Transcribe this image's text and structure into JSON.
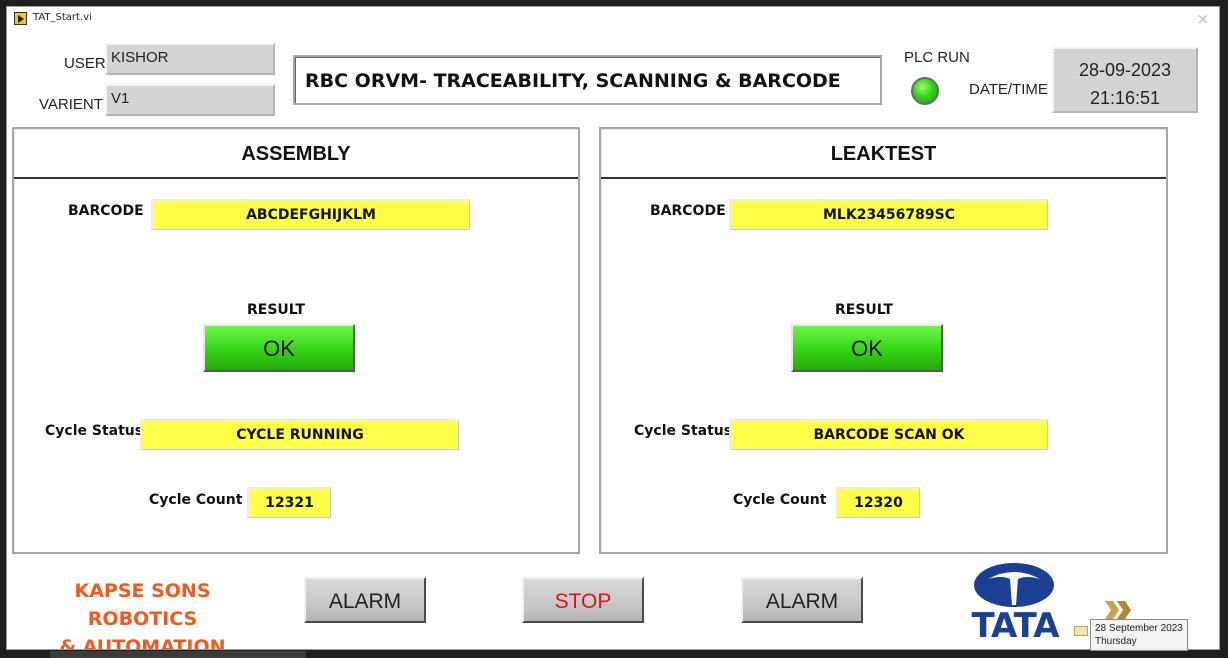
{
  "window": {
    "title": "TAT_Start.vi",
    "close_glyph": "×"
  },
  "header": {
    "user_label": "USER",
    "user_value": "KISHOR",
    "variant_label": "VARIENT",
    "variant_value": "V1",
    "app_title": "RBC ORVM- TRACEABILITY, SCANNING & BARCODE",
    "plc_label": "PLC RUN",
    "plc_led_color": "#36d21b",
    "datetime_label": "DATE/TIME",
    "date": "28-09-2023",
    "time": "21:16:51"
  },
  "assembly": {
    "title": "ASSEMBLY",
    "barcode_label": "BARCODE",
    "barcode_value": "ABCDEFGHIJKLM",
    "result_label": "RESULT",
    "result_value": "OK",
    "cycle_status_label": "Cycle Status",
    "cycle_status_value": "CYCLE RUNNING",
    "cycle_count_label": "Cycle Count",
    "cycle_count_value": "12321"
  },
  "leaktest": {
    "title": "LEAKTEST",
    "barcode_label": "BARCODE",
    "barcode_value": "MLK23456789SC",
    "result_label": "RESULT",
    "result_value": "OK",
    "cycle_status_label": "Cycle Status",
    "cycle_status_value": "BARCODE SCAN OK",
    "cycle_count_label": "Cycle Count",
    "cycle_count_value": "12320"
  },
  "footer": {
    "company_line1": "KAPSE SONS ROBOTICS",
    "company_line2": "& AUTOMATION",
    "alarm_left_label": "ALARM",
    "stop_label": "STOP",
    "alarm_right_label": "ALARM",
    "brand_text": "TATA",
    "colors": {
      "company": "#f25a1c",
      "stop_text": "#e31313",
      "brand_blue": "#1b3f93",
      "field_yellow": "#ffff4a",
      "ok_green": "#39d817"
    }
  },
  "taskbar": {
    "tooltip_date": "28 September 2023",
    "tooltip_day": "Thursday"
  }
}
